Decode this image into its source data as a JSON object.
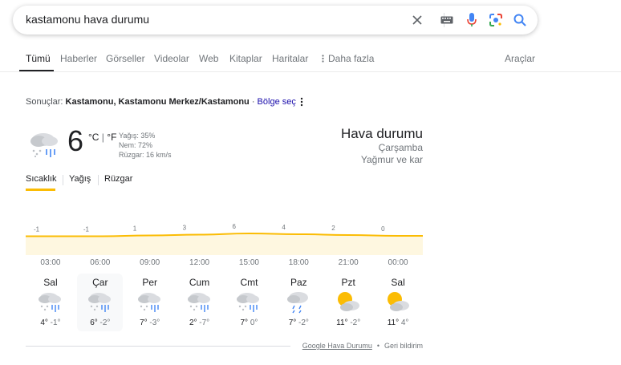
{
  "search": {
    "query": "kastamonu hava durumu"
  },
  "tabs": [
    {
      "label": "Tümü",
      "active": true
    },
    {
      "label": "Haberler"
    },
    {
      "label": "Görseller"
    },
    {
      "label": "Videolar"
    },
    {
      "label": "Web"
    },
    {
      "label": "Kitaplar"
    },
    {
      "label": "Haritalar"
    },
    {
      "label": "Daha fazla"
    }
  ],
  "tools_label": "Araçlar",
  "results_for": {
    "prefix": "Sonuçlar:",
    "location": "Kastamonu, Kastamonu Merkez/Kastamonu",
    "separator": " · ",
    "change_link": "Bölge seç"
  },
  "current": {
    "temp": "6",
    "unit_c": "°C",
    "unit_f": "°F",
    "precip": "Yağış: 35%",
    "humidity": "Nem: 72%",
    "wind": "Rüzgar: 16 km/s",
    "icon": "rain-snow-icon",
    "title": "Hava durumu",
    "day": "Çarşamba",
    "condition": "Yağmur ve kar"
  },
  "subtabs": [
    "Sıcaklık",
    "Yağış",
    "Rüzgar"
  ],
  "chart_data": {
    "type": "area",
    "x": [
      "03:00",
      "06:00",
      "09:00",
      "12:00",
      "15:00",
      "18:00",
      "21:00",
      "00:00"
    ],
    "values": [
      -1,
      -1,
      1,
      3,
      6,
      4,
      2,
      0
    ],
    "colors": {
      "line": "#fbbc04",
      "fill": "#fef7e0"
    }
  },
  "hours": [
    "03:00",
    "06:00",
    "09:00",
    "12:00",
    "15:00",
    "18:00",
    "21:00",
    "00:00"
  ],
  "days": [
    {
      "name": "Sal",
      "hi": "4°",
      "lo": "-1°",
      "icon": "rain-snow-icon",
      "selected": false
    },
    {
      "name": "Çar",
      "hi": "6°",
      "lo": "-2°",
      "icon": "rain-snow-icon",
      "selected": true
    },
    {
      "name": "Per",
      "hi": "7°",
      "lo": "-3°",
      "icon": "rain-snow-icon",
      "selected": false
    },
    {
      "name": "Cum",
      "hi": "2°",
      "lo": "-7°",
      "icon": "rain-snow-icon",
      "selected": false
    },
    {
      "name": "Cmt",
      "hi": "7°",
      "lo": "0°",
      "icon": "rain-snow-icon",
      "selected": false
    },
    {
      "name": "Paz",
      "hi": "7°",
      "lo": "-2°",
      "icon": "snow-showers-icon",
      "selected": false
    },
    {
      "name": "Pzt",
      "hi": "11°",
      "lo": "-2°",
      "icon": "partly-cloudy-icon",
      "selected": false
    },
    {
      "name": "Sal",
      "hi": "11°",
      "lo": "4°",
      "icon": "partly-cloudy-icon",
      "selected": false
    }
  ],
  "footer": {
    "source": "Google Hava Durumu",
    "bullet": "•",
    "feedback": "Geri bildirim"
  }
}
